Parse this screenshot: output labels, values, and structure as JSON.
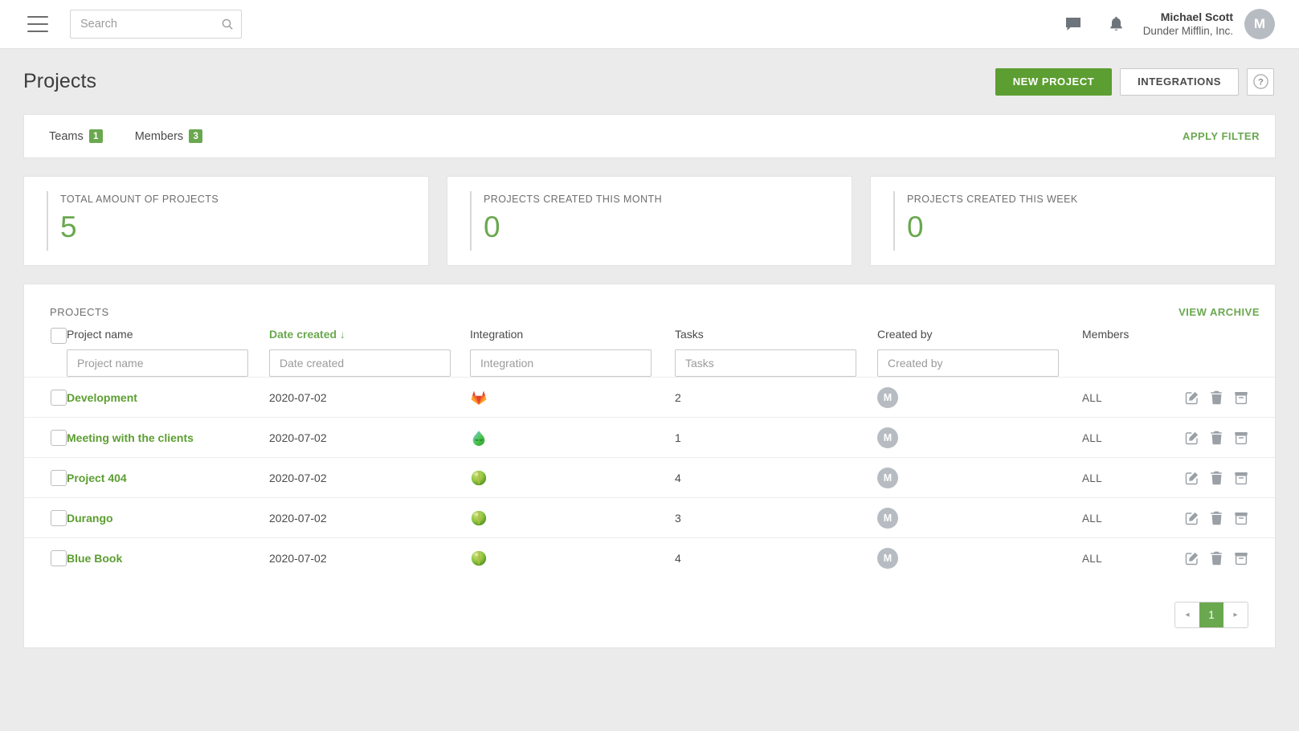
{
  "topbar": {
    "menu_icon": "hamburger-icon",
    "search": {
      "value": "",
      "placeholder": "Search",
      "icon": "search-icon"
    },
    "messages_icon": "chat-bubble-icon",
    "notifications_icon": "bell-icon",
    "user": {
      "name": "Michael Scott",
      "org": "Dunder Mifflin, Inc.",
      "avatar_initial": "M"
    }
  },
  "header": {
    "title": "Projects",
    "new_project_label": "NEW PROJECT",
    "integrations_label": "INTEGRATIONS",
    "help_icon": "question-mark-icon"
  },
  "filterbar": {
    "tabs": [
      {
        "label": "Teams",
        "count": "1"
      },
      {
        "label": "Members",
        "count": "3"
      }
    ],
    "apply_filter_label": "APPLY FILTER"
  },
  "stats": [
    {
      "label": "TOTAL AMOUNT OF PROJECTS",
      "value": "5"
    },
    {
      "label": "PROJECTS CREATED THIS MONTH",
      "value": "0"
    },
    {
      "label": "PROJECTS CREATED THIS WEEK",
      "value": "0"
    }
  ],
  "projects_panel": {
    "caption": "PROJECTS",
    "view_archive_label": "VIEW ARCHIVE",
    "columns": [
      {
        "key": "name",
        "label": "Project name",
        "placeholder": "Project name",
        "sorted": false
      },
      {
        "key": "date",
        "label": "Date created",
        "placeholder": "Date created",
        "sorted": true,
        "sort_arrow": "↓"
      },
      {
        "key": "integ",
        "label": "Integration",
        "placeholder": "Integration",
        "sorted": false
      },
      {
        "key": "tasks",
        "label": "Tasks",
        "placeholder": "Tasks",
        "sorted": false
      },
      {
        "key": "by",
        "label": "Created by",
        "placeholder": "Created by",
        "sorted": false
      },
      {
        "key": "mem",
        "label": "Members",
        "placeholder": "",
        "sorted": false
      }
    ],
    "filters": {
      "name": "",
      "date": "",
      "integ": "",
      "tasks": "",
      "by": ""
    },
    "rows": [
      {
        "name": "Development",
        "date": "2020-07-02",
        "integration_icon": "gitlab-icon",
        "tasks": "2",
        "created_by_initial": "M",
        "members": "ALL"
      },
      {
        "name": "Meeting with the clients",
        "date": "2020-07-02",
        "integration_icon": "sprout-icon",
        "tasks": "1",
        "created_by_initial": "M",
        "members": "ALL"
      },
      {
        "name": "Project 404",
        "date": "2020-07-02",
        "integration_icon": "sphere-icon",
        "tasks": "4",
        "created_by_initial": "M",
        "members": "ALL"
      },
      {
        "name": "Durango",
        "date": "2020-07-02",
        "integration_icon": "sphere-icon",
        "tasks": "3",
        "created_by_initial": "M",
        "members": "ALL"
      },
      {
        "name": "Blue Book",
        "date": "2020-07-02",
        "integration_icon": "sphere-icon",
        "tasks": "4",
        "created_by_initial": "M",
        "members": "ALL"
      }
    ],
    "row_action_icons": [
      "edit-icon",
      "trash-icon",
      "archive-icon"
    ],
    "pagination": {
      "prev": "◂",
      "current_page": "1",
      "next": "▸"
    }
  },
  "colors": {
    "accent_green": "#6aa84f",
    "button_green": "#5c9e31",
    "page_bg": "#ebebeb",
    "panel_bg": "#ffffff",
    "text": "#4a4a4a",
    "avatar_gray": "#b7bcc2"
  }
}
